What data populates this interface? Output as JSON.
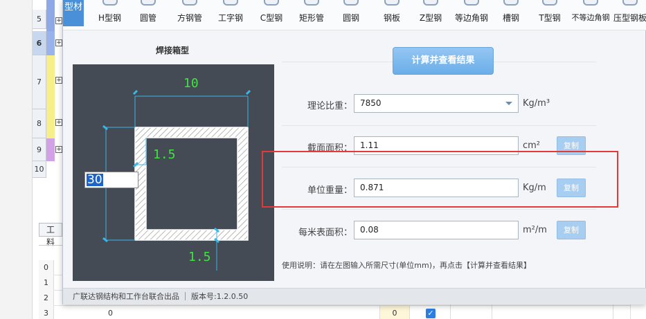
{
  "spreadsheet": {
    "row_headers": [
      "5",
      "6",
      "7",
      "8",
      "9",
      "10"
    ],
    "active_row": "6",
    "expander_glyph": "+",
    "tab_label": "工料",
    "bottom_rows": [
      {
        "num": "0",
        "text": "",
        "value": ""
      },
      {
        "num": "1",
        "text": "",
        "value": ""
      },
      {
        "num": "2",
        "text": "",
        "value": ""
      },
      {
        "num": "3",
        "text": "0",
        "value": "0"
      }
    ],
    "check_glyph": "✓"
  },
  "dialog": {
    "badge_text": "型材",
    "toolbar": [
      "H型钢",
      "圆管",
      "方钢管",
      "工字钢",
      "C型钢",
      "矩形管",
      "圆钢",
      "钢板",
      "Z型钢",
      "等边角钢",
      "槽钢",
      "T型钢",
      "不等边角钢",
      "压型钢板"
    ],
    "shape_title": "焊接箱型",
    "drawing": {
      "labels": {
        "width": "10",
        "thickness_side": "1.5",
        "thickness_bottom": "1.5"
      },
      "height_input": "30"
    },
    "calc_button": "计算并查看结果",
    "fields": {
      "density": {
        "label": "理论比重：",
        "value": "7850",
        "unit": "Kg/m³"
      },
      "area": {
        "label": "截面面积：",
        "value": "1.11",
        "unit": "cm²",
        "copy": "复制"
      },
      "unit_weight": {
        "label": "单位重量：",
        "value": "0.871",
        "unit": "Kg/m",
        "copy": "复制"
      },
      "surface": {
        "label": "每米表面积：",
        "value": "0.08",
        "unit": "m²/m",
        "copy": "复制"
      }
    },
    "usage_text": "使用说明：请在左图输入所需尺寸(单位mm)，再点击【计算并查看结果】",
    "status": {
      "publisher": "广联达钢结构和工作台联合出品",
      "version": "版本号:1.2.0.50"
    }
  },
  "colors": {
    "accent": "#4a90d9",
    "canvas_bg": "#454b54",
    "dimension_green": "#3fe53f",
    "dimension_cyan": "#38b7e8",
    "highlight_red": "#e53935"
  }
}
